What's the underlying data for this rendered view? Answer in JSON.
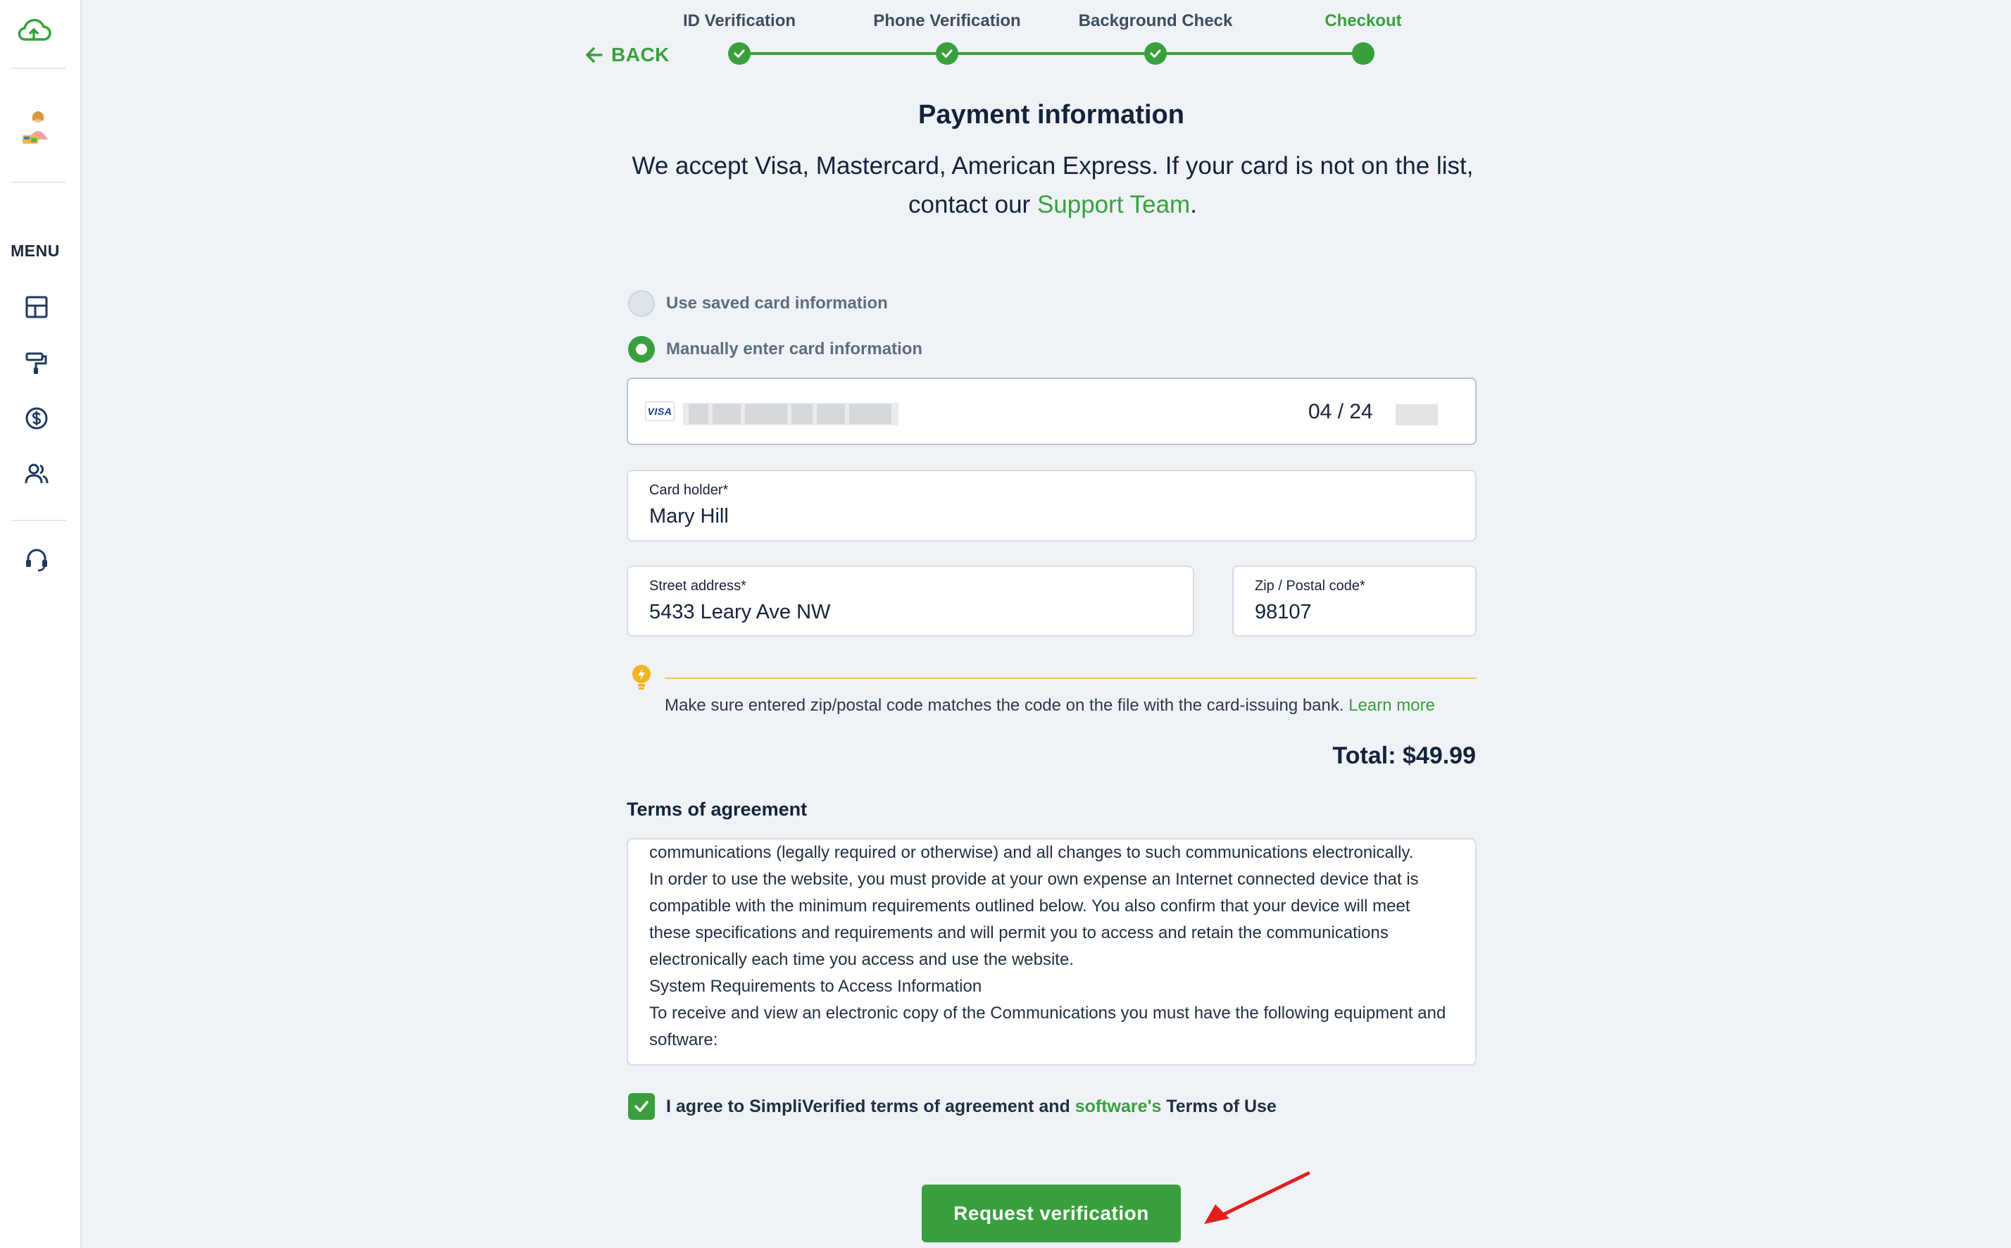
{
  "sidebar": {
    "menu_label": "MENU",
    "icons": [
      "cloud-upload-icon",
      "avatar",
      "dashboard-icon",
      "paint-roller-icon",
      "dollar-icon",
      "users-icon",
      "headset-icon"
    ]
  },
  "stepper": {
    "back_label": "BACK",
    "steps": [
      {
        "label": "ID Verification",
        "state": "done"
      },
      {
        "label": "Phone Verification",
        "state": "done"
      },
      {
        "label": "Background Check",
        "state": "done"
      },
      {
        "label": "Checkout",
        "state": "active"
      }
    ]
  },
  "payment": {
    "title": "Payment information",
    "subtitle_part1": "We accept Visa, Mastercard, American Express. If your card is not on the list,",
    "subtitle_part2": "contact our ",
    "support_link": "Support Team",
    "subtitle_end": ".",
    "options": [
      {
        "label": "Use saved card information",
        "selected": false
      },
      {
        "label": "Manually enter card information",
        "selected": true
      }
    ],
    "card": {
      "brand": "VISA",
      "expiry": "04 / 24"
    },
    "card_holder": {
      "label": "Card holder*",
      "value": "Mary Hill"
    },
    "street": {
      "label": "Street address*",
      "value": "5433 Leary Ave NW"
    },
    "zip": {
      "label": "Zip / Postal code*",
      "value": "98107"
    },
    "tip_text": "Make sure entered zip/postal code matches the code on the file with the card-issuing bank.",
    "tip_link": "Learn more",
    "total": "Total: $49.99"
  },
  "terms": {
    "title": "Terms of agreement",
    "lines": [
      "communications (legally required or otherwise) and all changes to such communications electronically.",
      "In order to use the website, you must provide at your own expense an Internet connected device that is compatible with the minimum requirements outlined below. You also confirm that your device will meet these specifications and requirements and will permit you to access and retain the communications electronically each time you access and use the website.",
      "System Requirements to Access Information",
      "To receive and view an electronic copy of the Communications you must have the following equipment and software:"
    ],
    "agree_text": "I agree to SimpliVerified terms of agreement and ",
    "agree_link": "software's",
    "agree_end": " Terms of Use",
    "agreed": true
  },
  "actions": {
    "submit_label": "Request verification"
  },
  "colors": {
    "accent": "#3aa03d",
    "background": "#eff3f8",
    "tip": "#f0c35a",
    "annotation_arrow": "#e0201c"
  }
}
